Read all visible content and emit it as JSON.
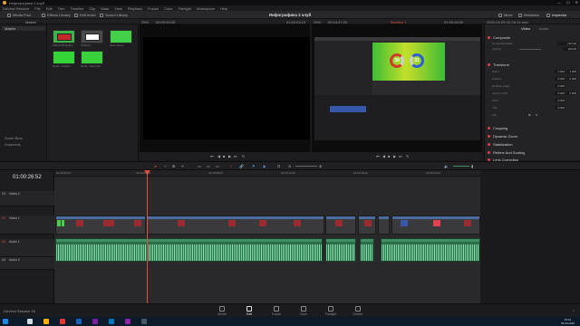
{
  "app": {
    "title": "Инфографика 2 клуб",
    "menu": [
      "DaVinci Resolve",
      "File",
      "Edit",
      "Trim",
      "Timeline",
      "Clip",
      "Mark",
      "View",
      "Playback",
      "Fusion",
      "Color",
      "Fairlight",
      "Workspace",
      "Help"
    ],
    "window_controls": [
      "—",
      "☐",
      "✕"
    ]
  },
  "toolbar": {
    "media_pool": "Media Pool",
    "effects_library": "Effects Library",
    "edit_index": "Edit Index",
    "sound_library": "Sound Library",
    "project_title": "Инфографика 2 клуб",
    "mixer": "Mixer",
    "metadata": "Metadata",
    "inspector": "Inspector"
  },
  "subbar": {
    "master": "Master",
    "src_zoom": "29%",
    "src_tc": "00:00:00:00",
    "src_dur": "01:02:03:15",
    "prog_zoom": "29%",
    "prog_tc": "00:19:27:20",
    "timeline_name": "Timeline 1",
    "prog_tc2": "01:00:26:52",
    "clip_name": "2020-03-05 22-28-14.mov"
  },
  "mediapool": {
    "folders": [
      "Master"
    ],
    "smart_bins": "Smart Bins",
    "keywords": "Keywords",
    "clips": [
      {
        "label": "2020-03-05 22-28-1...",
        "color": "#3db34a"
      },
      {
        "label": "Timeline 1",
        "color": "#4a4a4a"
      },
      {
        "label": "Green Screen",
        "color": "#43d14a"
      },
      {
        "label": "Футаж - Graphics...",
        "color": "#35d53a"
      },
      {
        "label": "Футаж - Video track",
        "color": "#39d23c"
      }
    ]
  },
  "viewer": {
    "left_value": "59",
    "right_value": "31",
    "left_color": "#d23a2c",
    "right_color": "#2f5fd0"
  },
  "inspector": {
    "tabs": [
      "Video",
      "Audio"
    ],
    "sections": [
      {
        "name": "Composite",
        "rows": [
          {
            "label": "Composite Mode",
            "value": "Normal"
          },
          {
            "label": "Opacity",
            "value": "100.00"
          }
        ]
      },
      {
        "name": "Transform",
        "rows": [
          {
            "label": "Zoom",
            "x": "1.000",
            "y": "1.000"
          },
          {
            "label": "Position",
            "x": "0.000",
            "y": "0.000"
          },
          {
            "label": "Rotation Angle",
            "x": "0.000",
            "y": ""
          },
          {
            "label": "Anchor Point",
            "x": "0.000",
            "y": "0.000"
          },
          {
            "label": "Pitch",
            "x": "0.000",
            "y": ""
          },
          {
            "label": "Yaw",
            "x": "0.000",
            "y": ""
          },
          {
            "label": "Flip",
            "x": "",
            "y": ""
          }
        ]
      },
      {
        "name": "Cropping",
        "rows": []
      },
      {
        "name": "Dynamic Zoom",
        "rows": []
      },
      {
        "name": "Stabilization",
        "rows": []
      },
      {
        "name": "Retime And Scaling",
        "rows": []
      },
      {
        "name": "Lens Correction",
        "rows": []
      }
    ]
  },
  "timeline": {
    "timecode": "01:00:26:52",
    "tracks": [
      {
        "id": "V2",
        "name": "Video 2"
      },
      {
        "id": "V1",
        "name": "Video 1"
      },
      {
        "id": "A1",
        "name": "Audio 1"
      },
      {
        "id": "A2",
        "name": "Audio 2"
      }
    ],
    "ruler": [
      "01:00:00:00",
      "01:00:04:00",
      "01:00:08:00",
      "01:00:12:00",
      "01:00:16:00",
      "01:00:20:00"
    ]
  },
  "pages": {
    "items": [
      "Media",
      "Cut",
      "Edit",
      "Fusion",
      "Color",
      "Fairlight",
      "Deliver"
    ],
    "active": "Edit"
  },
  "status": {
    "app_name": "DaVinci Resolve 16",
    "clock": "15:04",
    "date": "05.03.2020"
  },
  "colors": {
    "accent": "#e64d3d",
    "clip_video": "#4a6da0",
    "clip_audio": "#2d6e4a",
    "green": "#43d14a"
  }
}
